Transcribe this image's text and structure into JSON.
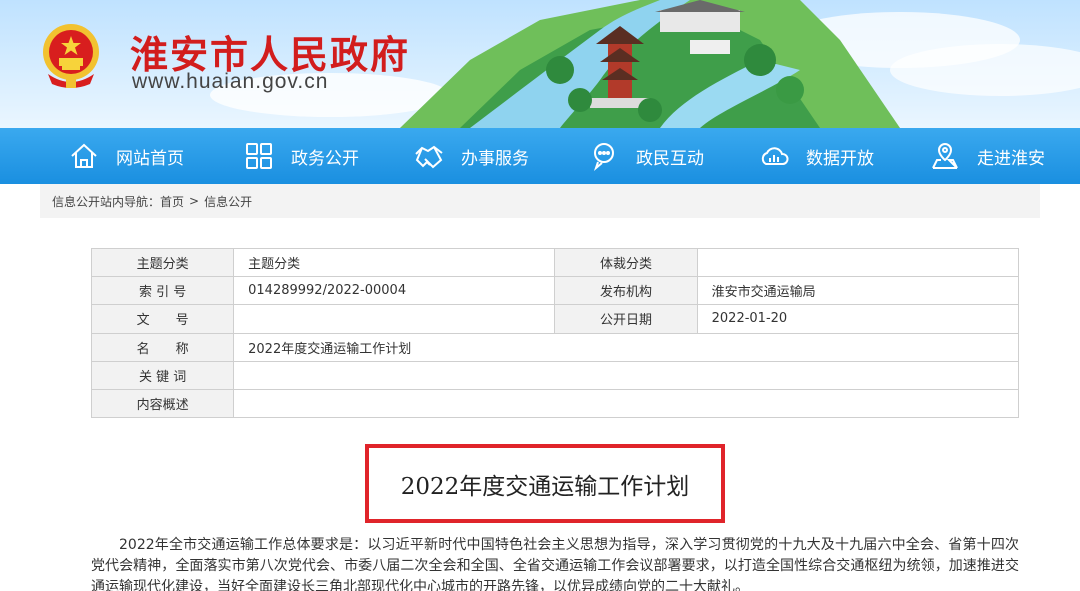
{
  "header": {
    "site_title": "淮安市人民政府",
    "site_url": "www.huaian.gov.cn"
  },
  "nav": [
    {
      "label": "网站首页",
      "icon": "home-icon"
    },
    {
      "label": "政务公开",
      "icon": "grid-icon"
    },
    {
      "label": "办事服务",
      "icon": "handshake-icon"
    },
    {
      "label": "政民互动",
      "icon": "chat-icon"
    },
    {
      "label": "数据开放",
      "icon": "cloud-data-icon"
    },
    {
      "label": "走进淮安",
      "icon": "location-pin-icon"
    }
  ],
  "breadcrumb": {
    "prefix": "信息公开站内导航：",
    "items": [
      "首页",
      "信息公开"
    ],
    "separator": ">"
  },
  "info": {
    "row1": {
      "label": "主题分类",
      "value": "主题分类",
      "label2": "体裁分类",
      "value2": ""
    },
    "row2": {
      "label": "索 引 号",
      "value": "014289992/2022-00004",
      "label2": "发布机构",
      "value2": "淮安市交通运输局"
    },
    "row3": {
      "label": "文　　号",
      "value": "",
      "label2": "公开日期",
      "value2": "2022-01-20"
    },
    "row4": {
      "label": "名　　称",
      "value": "2022年度交通运输工作计划"
    },
    "row5": {
      "label": "关 键 词",
      "value": ""
    },
    "row6": {
      "label": "内容概述",
      "value": ""
    }
  },
  "document": {
    "title": "2022年度交通运输工作计划",
    "paragraph": "2022年全市交通运输工作总体要求是：以习近平新时代中国特色社会主义思想为指导，深入学习贯彻党的十九大及十九届六中全会、省第十四次党代会精神，全面落实市第八次党代会、市委八届二次全会和全国、全省交通运输工作会议部署要求，以打造全国性综合交通枢纽为统领，加速推进交通运输现代化建设，当好全面建设长三角北部现代化中心城市的开路先锋，以优异成绩向党的二十大献礼。"
  },
  "colors": {
    "title_red": "#d21d1d",
    "nav_blue": "#1a8fe0",
    "highlight_border": "#e0242a"
  }
}
